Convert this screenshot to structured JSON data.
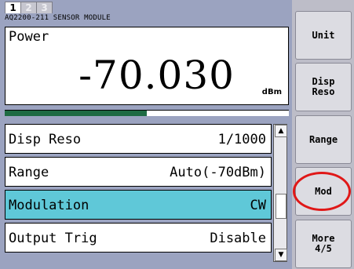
{
  "tabs": [
    {
      "label": "1",
      "active": true
    },
    {
      "label": "2",
      "active": false
    },
    {
      "label": "3",
      "active": false
    }
  ],
  "module_title": "AQ2200-211 SENSOR MODULE",
  "reading": {
    "label": "Power",
    "value": "-70.030",
    "unit": "dBm",
    "level_fraction": 0.5
  },
  "parameters": [
    {
      "name": "Disp Reso",
      "value": "1/1000",
      "selected": false
    },
    {
      "name": "Range",
      "value": "Auto(-70dBm)",
      "selected": false
    },
    {
      "name": "Modulation",
      "value": "CW",
      "selected": true
    },
    {
      "name": "Output Trig",
      "value": "Disable",
      "selected": false
    }
  ],
  "scrollbar": {
    "up_icon": "triangle-up-icon",
    "down_icon": "triangle-down-icon"
  },
  "softkeys": [
    {
      "label": "Unit"
    },
    {
      "label": "Disp\nReso"
    },
    {
      "label": "Range"
    },
    {
      "label": "Mod",
      "highlighted": true
    },
    {
      "label": "More\n4/5"
    }
  ],
  "colors": {
    "panel": "#9ba3c0",
    "selected_row": "#5fc8d8",
    "level_bar": "#1e6b43",
    "highlight_ring": "#e01818"
  }
}
